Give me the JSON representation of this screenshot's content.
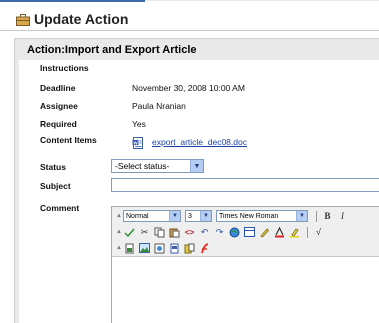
{
  "page": {
    "title": "Update Action"
  },
  "panel": {
    "heading": "Action:Import and Export Article"
  },
  "fields": {
    "instructions_label": "Instructions",
    "deadline_label": "Deadline",
    "deadline_value": "November 30, 2008 10:00 AM",
    "assignee_label": "Assignee",
    "assignee_value": "Paula Nranian",
    "required_label": "Required",
    "required_value": "Yes",
    "content_items_label": "Content Items",
    "content_item_file": "export_article_dec08.doc",
    "status_label": "Status",
    "status_value": "-Select status-",
    "subject_label": "Subject",
    "subject_value": "",
    "comment_label": "Comment"
  },
  "editor": {
    "format_value": "Normal",
    "size_value": "3",
    "font_value": "Times New Roman",
    "bold_glyph": "B",
    "italic_glyph": "I"
  },
  "icons": {
    "title": "briefcase-icon",
    "content_item": "word-document-icon",
    "dropdown": "chevron-down-icon"
  },
  "colors": {
    "link": "#1a44aa",
    "dropdown_button": "#b5cdf3",
    "panel_background": "#e9e9e9"
  }
}
